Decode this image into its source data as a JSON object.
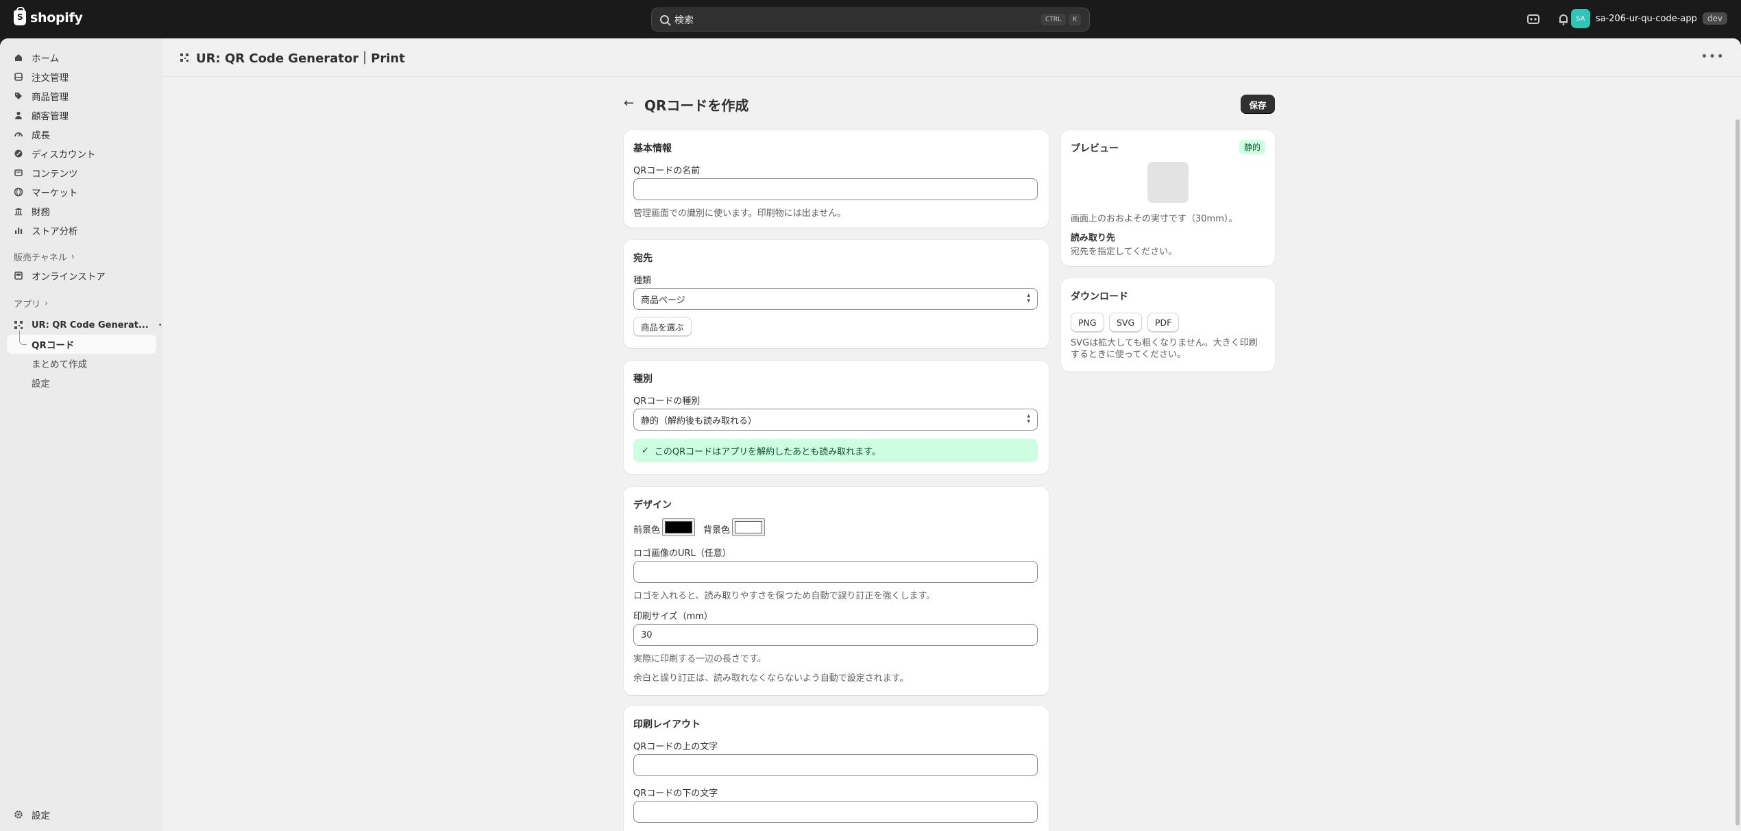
{
  "topbar": {
    "logo_text": "shopify",
    "search_placeholder": "検索",
    "shortcut_keys": [
      "CTRL",
      "K"
    ],
    "store_name": "sa-206-ur-qu-code-app",
    "avatar_initials": "SA",
    "env_tag": "dev"
  },
  "sidebar": {
    "items": [
      {
        "label": "ホーム",
        "icon": "home-icon"
      },
      {
        "label": "注文管理",
        "icon": "orders-icon"
      },
      {
        "label": "商品管理",
        "icon": "tag-icon"
      },
      {
        "label": "顧客管理",
        "icon": "person-icon"
      },
      {
        "label": "成長",
        "icon": "gauge-icon"
      },
      {
        "label": "ディスカウント",
        "icon": "discount-icon"
      },
      {
        "label": "コンテンツ",
        "icon": "content-icon"
      },
      {
        "label": "マーケット",
        "icon": "globe-icon"
      },
      {
        "label": "財務",
        "icon": "bank-icon"
      },
      {
        "label": "ストア分析",
        "icon": "bar-chart-icon"
      }
    ],
    "sales_channels_label": "販売チャネル",
    "online_store_label": "オンラインストア",
    "apps_label": "アプリ",
    "app_name": "UR: QR Code Generat...",
    "app_subitems": [
      "QRコード",
      "まとめて作成",
      "設定"
    ],
    "settings_label": "設定"
  },
  "app_header": {
    "title": "UR: QR Code Generator｜Print"
  },
  "page": {
    "title": "QRコードを作成",
    "save_label": "保存"
  },
  "basic": {
    "title": "基本情報",
    "name_label": "QRコードの名前",
    "name_value": "",
    "name_help": "管理画面での識別に使います。印刷物には出ません。"
  },
  "destination": {
    "title": "宛先",
    "type_label": "種類",
    "type_value": "商品ページ",
    "choose_product_label": "商品を選ぶ"
  },
  "kind": {
    "title": "種別",
    "kind_label": "QRコードの種別",
    "kind_value": "静的（解約後も読み取れる）",
    "banner_text": "このQRコードはアプリを解約したあとも読み取れます。"
  },
  "design": {
    "title": "デザイン",
    "fg_label": "前景色",
    "fg_color": "#000000",
    "bg_label": "背景色",
    "bg_color": "#ffffff",
    "logo_url_label": "ロゴ画像のURL（任意）",
    "logo_url_value": "",
    "logo_help": "ロゴを入れると、読み取りやすさを保つため自動で誤り訂正を強くします。",
    "print_size_label": "印刷サイズ（mm）",
    "print_size_value": "30",
    "print_size_help1": "実際に印刷する一辺の長さです。",
    "print_size_help2": "余白と誤り訂正は、読み取れなくならないよう自動で設定されます。"
  },
  "layout": {
    "title": "印刷レイアウト",
    "top_text_label": "QRコードの上の文字",
    "top_text_value": "",
    "bottom_text_label": "QRコードの下の文字",
    "bottom_text_value": ""
  },
  "preview": {
    "title": "プレビュー",
    "badge": "静的",
    "size_note": "画面上のおおよその実寸です（30mm）。",
    "read_dest_label": "読み取り先",
    "read_dest_text": "宛先を指定してください。"
  },
  "download": {
    "title": "ダウンロード",
    "buttons": [
      "PNG",
      "SVG",
      "PDF"
    ],
    "note": "SVGは拡大しても粗くなりません。大きく印刷するときに使ってください。"
  }
}
